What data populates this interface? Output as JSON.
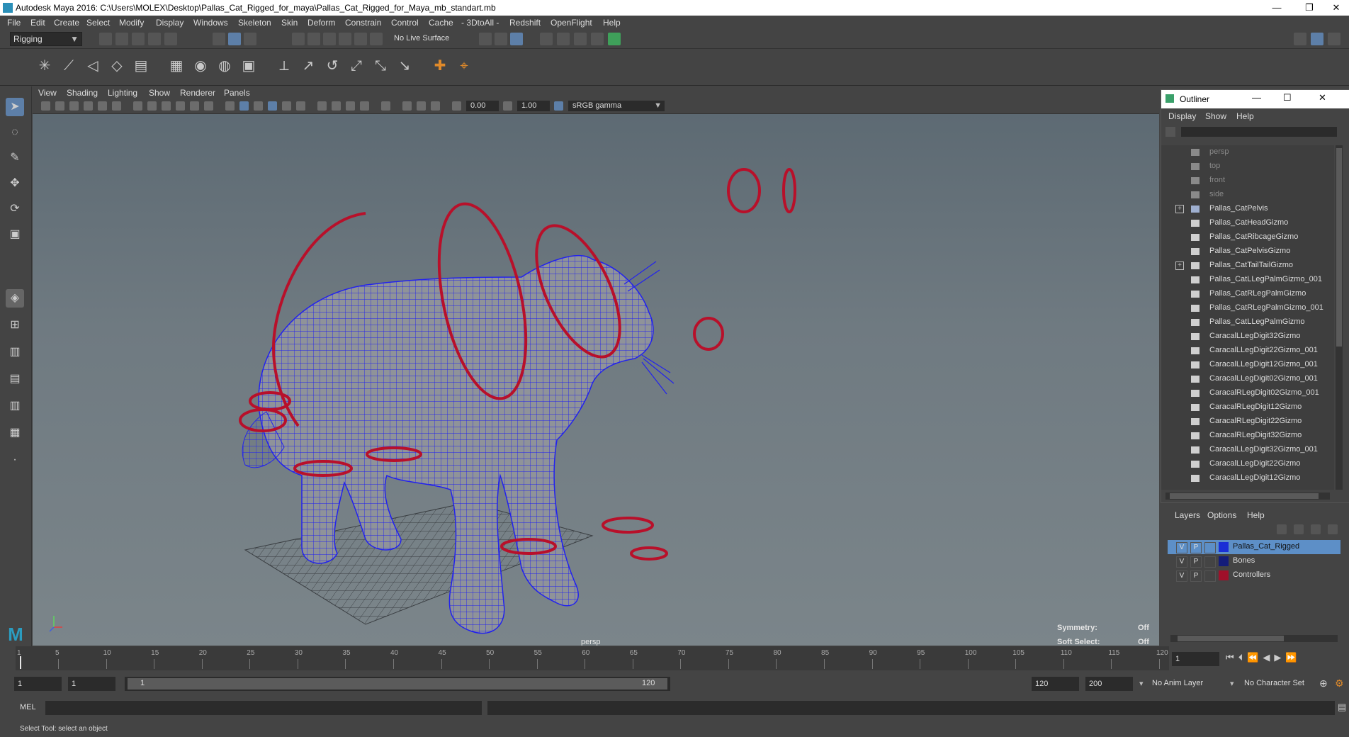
{
  "window": {
    "title": "Autodesk Maya 2016: C:\\Users\\MOLEX\\Desktop\\Pallas_Cat_Rigged_for_maya\\Pallas_Cat_Rigged_for_Maya_mb_standart.mb",
    "minimize": "—",
    "restore": "❐",
    "close": "✕"
  },
  "menubar": [
    "File",
    "Edit",
    "Create",
    "Select",
    "Modify",
    "Display",
    "Windows",
    "Skeleton",
    "Skin",
    "Deform",
    "Constrain",
    "Control",
    "Cache",
    "- 3DtoAll -",
    "Redshift",
    "OpenFlight",
    "Help"
  ],
  "statusline": {
    "menuset": "Rigging",
    "live_surface": "No Live Surface"
  },
  "viewport": {
    "menu": [
      "View",
      "Shading",
      "Lighting",
      "Show",
      "Renderer",
      "Panels"
    ],
    "exposure": "0.00",
    "gamma": "1.00",
    "colorspace": "sRGB gamma",
    "camera_label": "persp",
    "hud": {
      "symmetry_label": "Symmetry:",
      "symmetry_value": "Off",
      "soft_select_label": "Soft Select:",
      "soft_select_value": "Off"
    }
  },
  "outliner": {
    "title": "Outliner",
    "menu": [
      "Display",
      "Show",
      "Help"
    ],
    "items": [
      {
        "label": "persp",
        "kind": "camera"
      },
      {
        "label": "top",
        "kind": "camera"
      },
      {
        "label": "front",
        "kind": "camera"
      },
      {
        "label": "side",
        "kind": "camera"
      },
      {
        "label": "Pallas_CatPelvis",
        "kind": "joint",
        "expandable": true
      },
      {
        "label": "Pallas_CatHeadGizmo",
        "kind": "curve"
      },
      {
        "label": "Pallas_CatRibcageGizmo",
        "kind": "curve"
      },
      {
        "label": "Pallas_CatPelvisGizmo",
        "kind": "curve"
      },
      {
        "label": "Pallas_CatTailTailGizmo",
        "kind": "curve",
        "expandable": true
      },
      {
        "label": "Pallas_CatLLegPalmGizmo_001",
        "kind": "curve"
      },
      {
        "label": "Pallas_CatRLegPalmGizmo",
        "kind": "curve"
      },
      {
        "label": "Pallas_CatRLegPalmGizmo_001",
        "kind": "curve"
      },
      {
        "label": "Pallas_CatLLegPalmGizmo",
        "kind": "curve"
      },
      {
        "label": "CaracalLLegDigit32Gizmo",
        "kind": "curve"
      },
      {
        "label": "CaracalLLegDigit22Gizmo_001",
        "kind": "curve"
      },
      {
        "label": "CaracalLLegDigit12Gizmo_001",
        "kind": "curve"
      },
      {
        "label": "CaracalLLegDigit02Gizmo_001",
        "kind": "curve"
      },
      {
        "label": "CaracalRLegDigit02Gizmo_001",
        "kind": "curve"
      },
      {
        "label": "CaracalRLegDigit12Gizmo",
        "kind": "curve"
      },
      {
        "label": "CaracalRLegDigit22Gizmo",
        "kind": "curve"
      },
      {
        "label": "CaracalRLegDigit32Gizmo",
        "kind": "curve"
      },
      {
        "label": "CaracalLLegDigit32Gizmo_001",
        "kind": "curve"
      },
      {
        "label": "CaracalLLegDigit22Gizmo",
        "kind": "curve"
      },
      {
        "label": "CaracalLLegDigit12Gizmo",
        "kind": "curve"
      }
    ]
  },
  "layers": {
    "menu": [
      "Layers",
      "Options",
      "Help"
    ],
    "rows": [
      {
        "v": "V",
        "p": "P",
        "name": "Pallas_Cat_Rigged",
        "color": "#1a2fd6",
        "selected": true
      },
      {
        "v": "V",
        "p": "P",
        "name": "Bones",
        "color": "#141c7a",
        "selected": false
      },
      {
        "v": "V",
        "p": "P",
        "name": "Controllers",
        "color": "#a0102a",
        "selected": false
      }
    ]
  },
  "timeslider": {
    "ticks": [
      "1",
      "5",
      "10",
      "15",
      "20",
      "25",
      "30",
      "35",
      "40",
      "45",
      "50",
      "55",
      "60",
      "65",
      "70",
      "75",
      "80",
      "85",
      "90",
      "95",
      "100",
      "105",
      "110",
      "115",
      "120"
    ],
    "current_frame": "1"
  },
  "range": {
    "start": "1",
    "playback_start": "1",
    "slider_start": "1",
    "slider_end": "120",
    "playback_end": "120",
    "end": "200",
    "anim_layer": "No Anim Layer",
    "character_set": "No Character Set"
  },
  "cmdline": {
    "label": "MEL"
  },
  "helpline": {
    "text": "Select Tool: select an object"
  }
}
